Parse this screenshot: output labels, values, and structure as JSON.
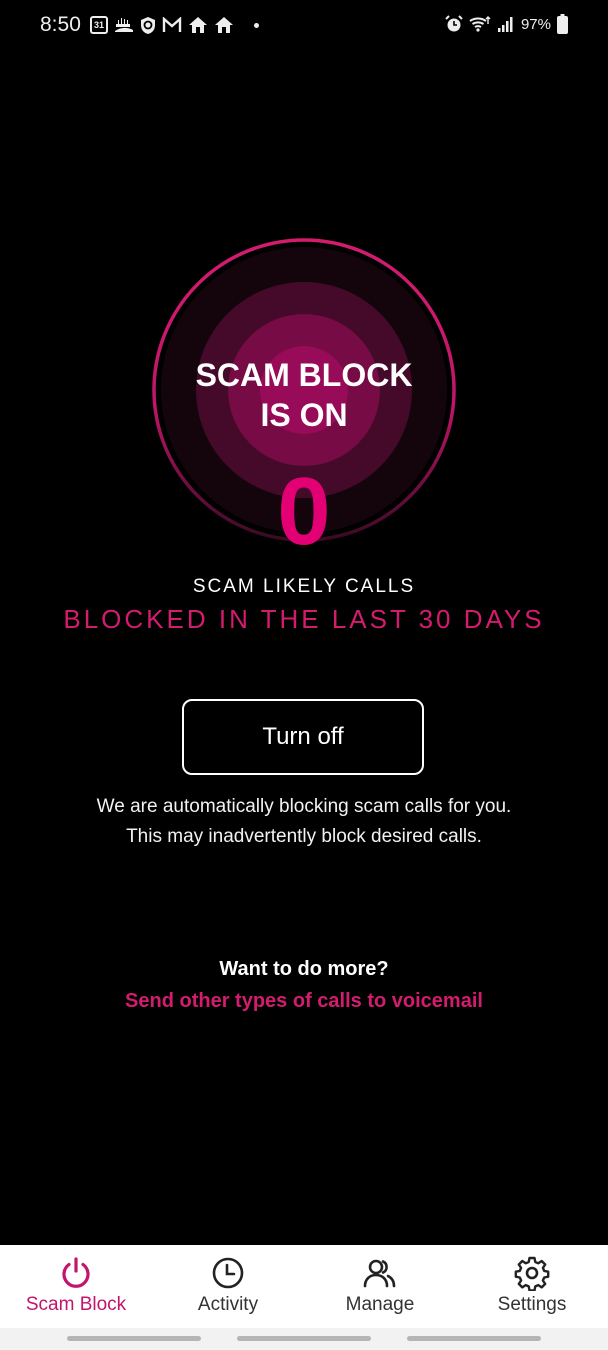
{
  "status_bar": {
    "time": "8:50",
    "calendar_day": "31",
    "left_icons": [
      "calendar-icon",
      "crowd-icon",
      "shield-icon",
      "gmail-icon",
      "home-icon",
      "home-icon",
      "notification-dot"
    ],
    "right_icons": [
      "alarm-icon",
      "wifi-icon",
      "signal-icon"
    ],
    "battery_percent": "97%"
  },
  "hero": {
    "title_line1": "SCAM BLOCK",
    "title_line2": "IS ON",
    "blocked_count": "0"
  },
  "stats": {
    "label_line1": "SCAM LIKELY CALLS",
    "label_line2": "BLOCKED IN THE LAST 30 DAYS"
  },
  "actions": {
    "turn_off_label": "Turn off"
  },
  "description": "We are automatically blocking scam calls for you. This may inadvertently block desired calls.",
  "more": {
    "title": "Want to do more?",
    "link": "Send other types of calls to voicemail"
  },
  "colors": {
    "accent": "#e20074",
    "accent_text": "#d41c6f",
    "background": "#000000"
  },
  "bottom_nav": {
    "active": "Scam Block",
    "items": [
      {
        "label": "Scam Block",
        "icon": "power-icon"
      },
      {
        "label": "Activity",
        "icon": "clock-icon"
      },
      {
        "label": "Manage",
        "icon": "people-icon"
      },
      {
        "label": "Settings",
        "icon": "gear-icon"
      }
    ]
  }
}
